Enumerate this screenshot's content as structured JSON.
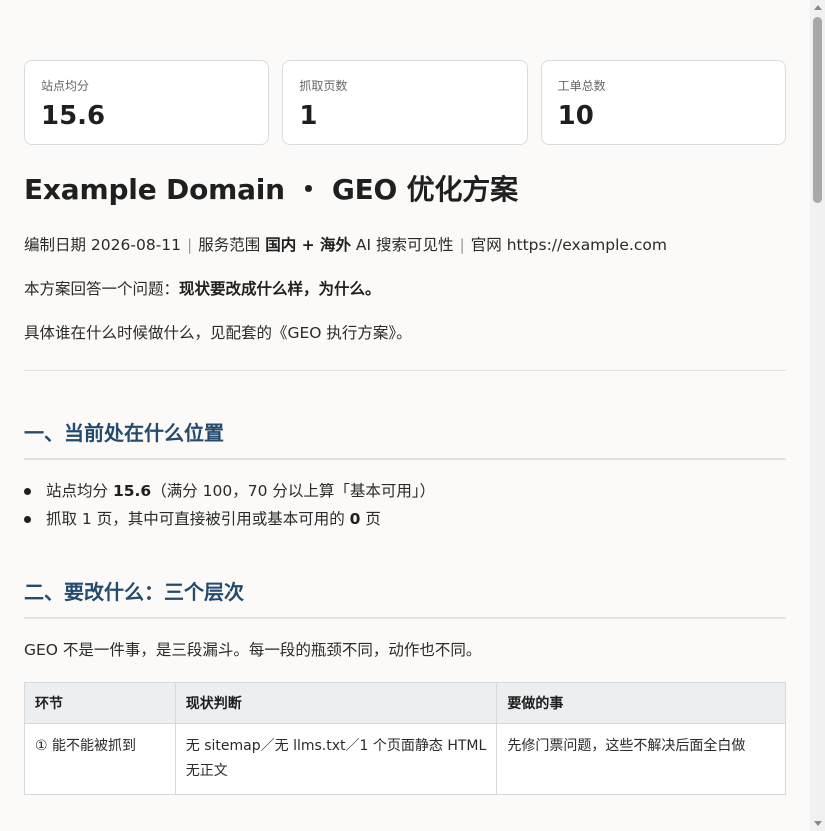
{
  "stats": [
    {
      "label": "站点均分",
      "value": "15.6"
    },
    {
      "label": "抓取页数",
      "value": "1"
    },
    {
      "label": "工单总数",
      "value": "10"
    }
  ],
  "title": "Example Domain ・ GEO 优化方案",
  "meta": {
    "date": "编制日期 2026-08-11",
    "sep": "|",
    "scope_prefix": "服务范围",
    "scope_bold": "国内 + 海外",
    "scope_suffix": "AI 搜索可见性",
    "site": "官网 https://example.com"
  },
  "intro": {
    "q_prefix": "本方案回答一个问题：",
    "q_bold": "现状要改成什么样，为什么。",
    "p2": "具体谁在什么时候做什么，见配套的《GEO 执行方案》。"
  },
  "section1": {
    "heading": "一、当前处在什么位置",
    "bullet1_prefix": "站点均分",
    "bullet1_bold": "15.6",
    "bullet1_suffix": "（满分 100，70 分以上算「基本可用」）",
    "bullet2_prefix": "抓取 1 页，其中可直接被引用或基本可用的",
    "bullet2_bold": "0",
    "bullet2_suffix": "页"
  },
  "section2": {
    "heading": "二、要改什么：三个层次",
    "intro": "GEO 不是一件事，是三段漏斗。每一段的瓶颈不同，动作也不同。",
    "table": {
      "headers": [
        "环节",
        "现状判断",
        "要做的事"
      ],
      "rows": [
        [
          "① 能不能被抓到",
          "无 sitemap／无 llms.txt／1 个页面静态 HTML 无正文",
          "先修门票问题，这些不解决后面全白做"
        ]
      ]
    }
  },
  "colors": {
    "heading": "#244a6e",
    "background": "#fbfaf8",
    "table_header": "#eceef0"
  }
}
